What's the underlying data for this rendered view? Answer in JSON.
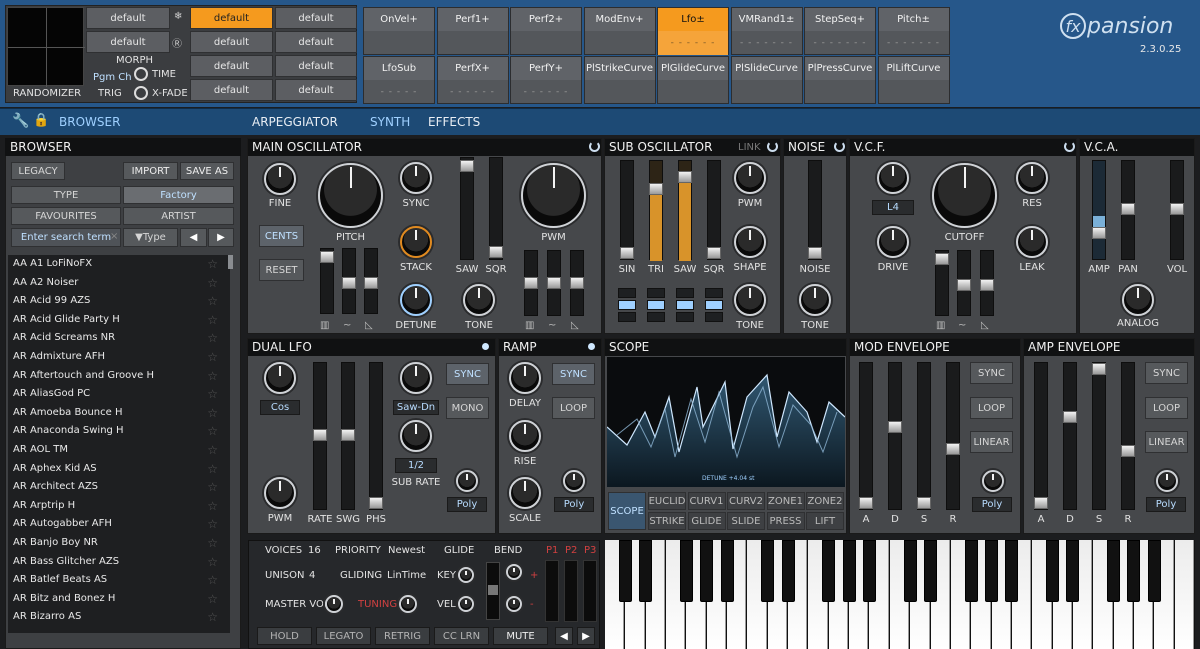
{
  "randomizer": {
    "label": "RANDOMIZER",
    "morph": "MORPH",
    "pgm": "Pgm Ch",
    "time": "TIME",
    "trig": "TRIG",
    "xfade": "X-FADE"
  },
  "presets": {
    "a1": "default",
    "a2": "default",
    "b1": "default",
    "b2": "default",
    "b3": "default",
    "b4": "default",
    "c1": "default",
    "c2": "default",
    "c3": "default",
    "c4": "default"
  },
  "macros": [
    {
      "t": "OnVel+",
      "d": ""
    },
    {
      "t": "Perf1+",
      "d": ""
    },
    {
      "t": "Perf2+",
      "d": ""
    },
    {
      "t": "ModEnv+",
      "d": ""
    },
    {
      "t": "Lfo±",
      "d": "- - - - - -"
    },
    {
      "t": "VMRand1±",
      "d": "- - - - - - -"
    },
    {
      "t": "StepSeq+",
      "d": "- - - - - - -"
    },
    {
      "t": "Pitch±",
      "d": "- - - - - - -"
    },
    {
      "t": "LfoSub",
      "d": "- - - - -"
    },
    {
      "t": "PerfX+",
      "d": "- - - - - -"
    },
    {
      "t": "PerfY+",
      "d": "- - - - - -"
    },
    {
      "t": "PlStrikeCurve",
      "d": ""
    },
    {
      "t": "PlGlideCurve",
      "d": ""
    },
    {
      "t": "PlSlideCurve",
      "d": ""
    },
    {
      "t": "PlPressCurve",
      "d": ""
    },
    {
      "t": "PlLiftCurve",
      "d": ""
    }
  ],
  "brand": {
    "name": "fxpansion",
    "version": "2.3.0.25"
  },
  "nav": {
    "browser": "BROWSER",
    "arp": "ARPEGGIATOR",
    "synth": "SYNTH",
    "effects": "EFFECTS"
  },
  "browser": {
    "title": "BROWSER",
    "legacy": "LEGACY",
    "import": "IMPORT",
    "saveas": "SAVE AS",
    "type": "TYPE",
    "factory": "Factory",
    "favourites": "FAVOURITES",
    "artist": "ARTIST",
    "search": "Enter search term",
    "filter": "▼Type",
    "items": [
      "AA A1 LoFiNoFX",
      "AA A2 Noiser",
      "AR Acid 99 AZS",
      "AR Acid Glide Party H",
      "AR Acid Screams NR",
      "AR Admixture AFH",
      "AR Aftertouch and Groove H",
      "AR AliasGod PC",
      "AR Amoeba Bounce H",
      "AR Anaconda Swing H",
      "AR AOL TM",
      "AR Aphex Kid AS",
      "AR Architect AZS",
      "AR Arptrip H",
      "AR Autogabber AFH",
      "AR Banjo Boy NR",
      "AR Bass Glitcher AZS",
      "AR Batlef Beats AS",
      "AR Bitz and Bonez H",
      "AR Bizarro AS"
    ]
  },
  "mainosc": {
    "title": "MAIN OSCILLATOR",
    "fine": "FINE",
    "pitch": "PITCH",
    "sync": "SYNC",
    "pwm": "PWM",
    "cents": "CENTS",
    "reset": "RESET",
    "stack": "STACK",
    "detune": "DETUNE",
    "saw": "SAW",
    "sqr": "SQR",
    "tone": "TONE"
  },
  "subosc": {
    "title": "SUB OSCILLATOR",
    "link": "LINK",
    "sin": "SIN",
    "tri": "TRI",
    "saw": "SAW",
    "sqr": "SQR",
    "pwm": "PWM",
    "shape": "SHAPE",
    "tone": "TONE"
  },
  "noise": {
    "title": "NOISE",
    "noise": "NOISE",
    "tone": "TONE"
  },
  "vcf": {
    "title": "V.C.F.",
    "mode": "L4",
    "cutoff": "CUTOFF",
    "res": "RES",
    "drive": "DRIVE",
    "leak": "LEAK"
  },
  "vca": {
    "title": "V.C.A.",
    "amp": "AMP",
    "pan": "PAN",
    "vol": "VOL",
    "analog": "ANALOG"
  },
  "lfo": {
    "title": "DUAL LFO",
    "shape1": "Cos",
    "shape2": "Saw-Dn",
    "sync": "SYNC",
    "mono": "MONO",
    "subrate_val": "1/2",
    "subrate": "SUB RATE",
    "pwm": "PWM",
    "rate": "RATE",
    "swg": "SWG",
    "phs": "PHS",
    "poly": "Poly"
  },
  "ramp": {
    "title": "RAMP",
    "sync": "SYNC",
    "delay": "DELAY",
    "loop": "LOOP",
    "rise": "RISE",
    "scale": "SCALE",
    "poly": "Poly"
  },
  "scope": {
    "title": "SCOPE",
    "readout": "DETUNE +4.04 st",
    "tab": "SCOPE",
    "tabs": [
      "EUCLID",
      "CURV1",
      "CURV2",
      "ZONE1",
      "ZONE2",
      "STRIKE",
      "GLIDE",
      "SLIDE",
      "PRESS",
      "LIFT"
    ]
  },
  "modenv": {
    "title": "MOD ENVELOPE",
    "sync": "SYNC",
    "loop": "LOOP",
    "linear": "LINEAR",
    "poly": "Poly",
    "a": "A",
    "d": "D",
    "s": "S",
    "r": "R"
  },
  "ampenv": {
    "title": "AMP ENVELOPE",
    "sync": "SYNC",
    "loop": "LOOP",
    "linear": "LINEAR",
    "poly": "Poly",
    "a": "A",
    "d": "D",
    "s": "S",
    "r": "R"
  },
  "perf": {
    "voices": "VOICES",
    "voices_v": "16",
    "priority": "PRIORITY",
    "priority_v": "Newest",
    "glide": "GLIDE",
    "bend": "BEND",
    "unison": "UNISON",
    "unison_v": "4",
    "gliding": "GLIDING",
    "gliding_v": "LinTime",
    "key": "KEY",
    "mastervol": "MASTER VOL",
    "tuning": "TUNING",
    "vel": "VEL",
    "p1": "P1",
    "p2": "P2",
    "p3": "P3",
    "hold": "HOLD",
    "legato": "LEGATO",
    "retrig": "RETRIG",
    "cclrn": "CC LRN",
    "mute": "MUTE"
  }
}
